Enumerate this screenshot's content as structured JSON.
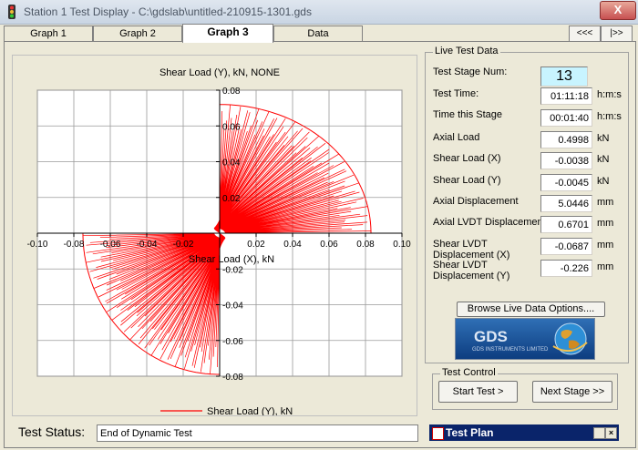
{
  "window": {
    "title": "Station 1 Test Display - C:\\gdslab\\untitled-210915-1301.gds",
    "close_label": "X"
  },
  "tabs": [
    {
      "label": "Graph 1"
    },
    {
      "label": "Graph 2"
    },
    {
      "label": "Graph 3"
    },
    {
      "label": "Data"
    }
  ],
  "active_tab": "Graph 3",
  "tab_nav": {
    "prev_label": "<<<",
    "next_label": "|>>"
  },
  "chart_data": {
    "type": "scatter",
    "title": "Shear Load (Y), kN, NONE",
    "xlabel": "Shear Load (X), kN",
    "ylabel": "",
    "xlim": [
      -0.1,
      0.1
    ],
    "ylim": [
      -0.08,
      0.08
    ],
    "x_ticks": [
      "-0.10",
      "-0.08",
      "-0.06",
      "-0.04",
      "-0.02",
      "0.02",
      "0.04",
      "0.06",
      "0.08",
      "0.10"
    ],
    "y_ticks": [
      "0.08",
      "0.06",
      "0.04",
      "0.02",
      "-0.02",
      "-0.04",
      "-0.06",
      "-0.08"
    ],
    "grid": true,
    "legend": [
      {
        "name": "Shear Load (Y), kN",
        "color": "#ff0000"
      }
    ],
    "series": [
      {
        "name": "Shear Load (Y), kN",
        "color": "#ff0000",
        "lobes": [
          {
            "quadrant": "upper-right",
            "x_max": 0.083,
            "y_max": 0.072
          },
          {
            "quadrant": "lower-left",
            "x_min": -0.075,
            "y_min": -0.079
          }
        ]
      }
    ]
  },
  "live_data": {
    "title": "Live Test Data",
    "rows": [
      {
        "label": "Test Stage Num:",
        "value": "13",
        "unit": ""
      },
      {
        "label": "Test Time:",
        "value": "01:11:18",
        "unit": "h:m:s"
      },
      {
        "label": "Time this Stage",
        "value": "00:01:40",
        "unit": "h:m:s"
      },
      {
        "label": "Axial Load",
        "value": "0.4998",
        "unit": "kN"
      },
      {
        "label": "Shear Load (X)",
        "value": "-0.0038",
        "unit": "kN"
      },
      {
        "label": "Shear Load (Y)",
        "value": "-0.0045",
        "unit": "kN"
      },
      {
        "label": "Axial Displacement",
        "value": "5.0446",
        "unit": "mm"
      },
      {
        "label": "Axial LVDT Displacement",
        "value": "0.6701",
        "unit": "mm"
      },
      {
        "label": "Shear LVDT Displacement (X)",
        "value": "-0.0687",
        "unit": "mm"
      },
      {
        "label": "Shear LVDT Displacement (Y)",
        "value": "-0.226",
        "unit": "mm"
      }
    ],
    "browse_button": "Browse Live Data Options....",
    "logo_text": "GDS",
    "logo_subtext": "GDS INSTRUMENTS LIMITED"
  },
  "test_control": {
    "title": "Test Control",
    "start_label": "Start Test >",
    "next_label": "Next Stage >>"
  },
  "status": {
    "label": "Test Status:",
    "value": "End of Dynamic Test"
  },
  "test_plan": {
    "title": "Test Plan"
  }
}
